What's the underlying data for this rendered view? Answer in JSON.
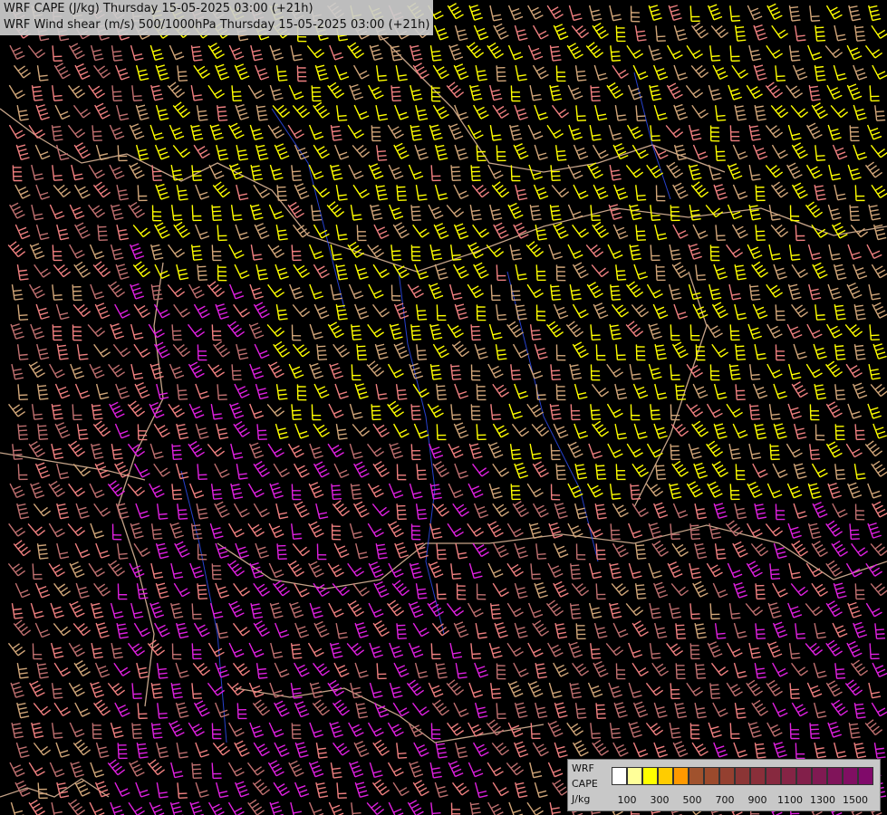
{
  "titles": {
    "line1": "WRF CAPE (J/kg) Thursday 15-05-2025 03:00 (+21h)",
    "line2": "WRF Wind shear (m/s) 500/1000hPa Thursday 15-05-2025 03:00 (+21h)"
  },
  "legend": {
    "label1": "WRF",
    "label2": "CAPE",
    "label3": "J/kg",
    "swatch_colors": [
      "#ffffff",
      "#ffff99",
      "#ffff00",
      "#ffcc00",
      "#ff9900",
      "#a0522d",
      "#9b4a2c",
      "#944030",
      "#8b3535",
      "#8a2f3a",
      "#87293f",
      "#852445",
      "#821f4a",
      "#801a52",
      "#80145a",
      "#800f62",
      "#800a6a"
    ],
    "ticks": [
      "100",
      "300",
      "500",
      "700",
      "900",
      "1100",
      "1300",
      "1500"
    ]
  },
  "colors": {
    "background": "#000000",
    "barb_yellow": "#ffff00",
    "barb_tan": "#d2a679",
    "barb_salmon": "#f08080",
    "barb_rose": "#c07070",
    "barb_magenta": "#e020e0",
    "border_lines": "#e8c0a0",
    "rivers": "#3050ff"
  }
}
